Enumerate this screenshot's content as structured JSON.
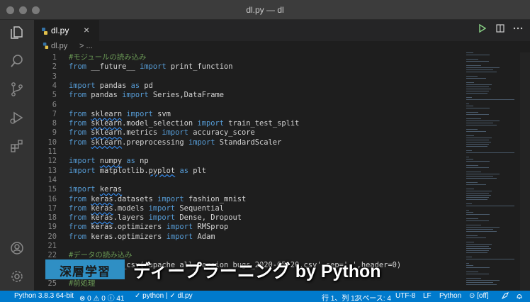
{
  "window": {
    "title": "dl.py — dl"
  },
  "tab": {
    "label": "dl.py",
    "close": "×"
  },
  "breadcrumb": {
    "file": "dl.py",
    "rest": "> ..."
  },
  "editor": {
    "lines": [
      {
        "n": "1",
        "tokens": [
          {
            "t": "#モジュールの読み込み",
            "c": "cm"
          }
        ]
      },
      {
        "n": "2",
        "tokens": [
          {
            "t": "from",
            "c": "kw"
          },
          {
            "t": " __future__ "
          },
          {
            "t": "import",
            "c": "kw"
          },
          {
            "t": " print_function"
          }
        ]
      },
      {
        "n": "3",
        "tokens": []
      },
      {
        "n": "4",
        "tokens": [
          {
            "t": "import",
            "c": "kw"
          },
          {
            "t": " pandas "
          },
          {
            "t": "as",
            "c": "kw"
          },
          {
            "t": " pd"
          }
        ]
      },
      {
        "n": "5",
        "tokens": [
          {
            "t": "from",
            "c": "kw"
          },
          {
            "t": " pandas "
          },
          {
            "t": "import",
            "c": "kw"
          },
          {
            "t": " Series,DataFrame"
          }
        ]
      },
      {
        "n": "6",
        "tokens": []
      },
      {
        "n": "7",
        "tokens": [
          {
            "t": "from",
            "c": "kw"
          },
          {
            "t": " "
          },
          {
            "t": "sklearn",
            "c": "mod"
          },
          {
            "t": " "
          },
          {
            "t": "import",
            "c": "kw"
          },
          {
            "t": " svm"
          }
        ]
      },
      {
        "n": "8",
        "tokens": [
          {
            "t": "from",
            "c": "kw"
          },
          {
            "t": " "
          },
          {
            "t": "sklearn",
            "c": "mod"
          },
          {
            "t": ".model_selection "
          },
          {
            "t": "import",
            "c": "kw"
          },
          {
            "t": " train_test_split"
          }
        ]
      },
      {
        "n": "9",
        "tokens": [
          {
            "t": "from",
            "c": "kw"
          },
          {
            "t": " "
          },
          {
            "t": "sklearn",
            "c": "mod"
          },
          {
            "t": ".metrics "
          },
          {
            "t": "import",
            "c": "kw"
          },
          {
            "t": " accuracy_score"
          }
        ]
      },
      {
        "n": "10",
        "tokens": [
          {
            "t": "from",
            "c": "kw"
          },
          {
            "t": " "
          },
          {
            "t": "sklearn",
            "c": "mod"
          },
          {
            "t": ".preprocessing "
          },
          {
            "t": "import",
            "c": "kw"
          },
          {
            "t": " StandardScaler"
          }
        ]
      },
      {
        "n": "11",
        "tokens": []
      },
      {
        "n": "12",
        "tokens": [
          {
            "t": "import",
            "c": "kw"
          },
          {
            "t": " "
          },
          {
            "t": "numpy",
            "c": "mod"
          },
          {
            "t": " "
          },
          {
            "t": "as",
            "c": "kw"
          },
          {
            "t": " np"
          }
        ]
      },
      {
        "n": "13",
        "tokens": [
          {
            "t": "import",
            "c": "kw"
          },
          {
            "t": " matplotlib."
          },
          {
            "t": "pyplot",
            "c": "mod"
          },
          {
            "t": " "
          },
          {
            "t": "as",
            "c": "kw"
          },
          {
            "t": " plt"
          }
        ]
      },
      {
        "n": "14",
        "tokens": []
      },
      {
        "n": "15",
        "tokens": [
          {
            "t": "import",
            "c": "kw"
          },
          {
            "t": " "
          },
          {
            "t": "keras",
            "c": "mod"
          }
        ]
      },
      {
        "n": "16",
        "tokens": [
          {
            "t": "from",
            "c": "kw"
          },
          {
            "t": " "
          },
          {
            "t": "keras",
            "c": "mod"
          },
          {
            "t": ".datasets "
          },
          {
            "t": "import",
            "c": "kw"
          },
          {
            "t": " fashion_mnist"
          }
        ]
      },
      {
        "n": "17",
        "tokens": [
          {
            "t": "from",
            "c": "kw"
          },
          {
            "t": " "
          },
          {
            "t": "keras",
            "c": "mod"
          },
          {
            "t": ".models "
          },
          {
            "t": "import",
            "c": "kw"
          },
          {
            "t": " Sequential"
          }
        ]
      },
      {
        "n": "18",
        "tokens": [
          {
            "t": "from",
            "c": "kw"
          },
          {
            "t": " "
          },
          {
            "t": "keras",
            "c": "mod"
          },
          {
            "t": ".layers "
          },
          {
            "t": "import",
            "c": "kw"
          },
          {
            "t": " Dense, Dropout"
          }
        ]
      },
      {
        "n": "19",
        "tokens": [
          {
            "t": "from",
            "c": "kw"
          },
          {
            "t": " keras.optimizers "
          },
          {
            "t": "import",
            "c": "kw"
          },
          {
            "t": " RMSprop"
          }
        ]
      },
      {
        "n": "20",
        "tokens": [
          {
            "t": "from",
            "c": "kw"
          },
          {
            "t": " keras.optimizers "
          },
          {
            "t": "import",
            "c": "kw"
          },
          {
            "t": " Adam"
          }
        ]
      },
      {
        "n": "21",
        "tokens": []
      },
      {
        "n": "22",
        "tokens": [
          {
            "t": "#データの読み込み",
            "c": "cm"
          }
        ]
      },
      {
        "n": "23",
        "tokens": [
          {
            "t": "df = pd.read_csv('apache_all_version_bugs_2020-05-20.csv',sep=',',header=0)"
          }
        ]
      },
      {
        "n": "24",
        "tokens": []
      },
      {
        "n": "25",
        "tokens": [
          {
            "t": "#前処理",
            "c": "cm"
          }
        ]
      }
    ]
  },
  "statusbar": {
    "python": "Python 3.8.3 64-bit",
    "problems": "⊗ 0 ⚠ 0 ⓘ 41",
    "check": "✓ python | ✓ dl.py",
    "position": "行 1、列 12",
    "spaces": "スペース: 4",
    "encoding": "UTF-8",
    "eol": "LF",
    "language": "Python",
    "off": "⊙ [off]"
  },
  "overlay": {
    "banner": "深層学習",
    "title": "ディープラーニング by Python"
  },
  "colors": {
    "accent": "#007acc",
    "keyword": "#569cd6",
    "comment": "#6a9955",
    "text": "#d4d4d4",
    "banner": "#2f8fc4"
  },
  "icons": {
    "activity": [
      "files-icon",
      "search-icon",
      "source-control-icon",
      "run-debug-icon",
      "extensions-icon",
      "account-icon",
      "settings-gear-icon"
    ],
    "tab": [
      "python-file-icon",
      "close-icon",
      "run-icon",
      "split-editor-icon",
      "more-actions-icon"
    ]
  }
}
